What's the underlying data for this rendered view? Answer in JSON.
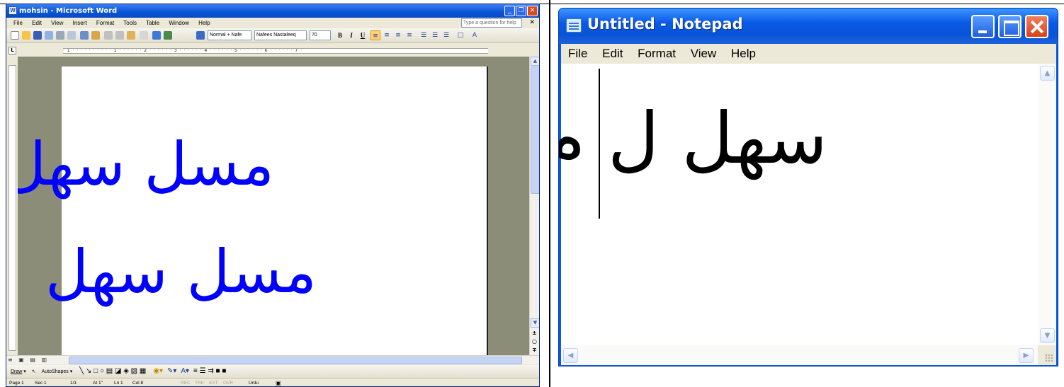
{
  "word": {
    "title": "mohsin - Microsoft Word",
    "caption_buttons": [
      "_",
      "❐",
      "✕"
    ],
    "menus": [
      "File",
      "Edit",
      "View",
      "Insert",
      "Format",
      "Tools",
      "Table",
      "Window",
      "Help"
    ],
    "help_box_placeholder": "Type a question for help",
    "help_close": "✕",
    "toolbar": {
      "style_value": "Normal + Nafe",
      "font_value": "Nafees Nastaleeq",
      "size_value": "70",
      "bold": "B",
      "italic": "I",
      "underline": "U"
    },
    "ruler_text": "· 1 · · · · · · · · · · 1 · · · · · · 2 · · · · · · 3 · · · · · · 4 · · · · · · 5 · · · · · · 6 · · · · · · 7 ·",
    "ruler_button": "L",
    "document_lines": [
      "مسل سهل",
      "مسل سهل"
    ],
    "draw_toolbar": {
      "draw": "Draw",
      "autoshapes": "AutoShapes"
    },
    "status": {
      "page": "Page 1",
      "sec": "Sec 1",
      "pages": "1/1",
      "at": "At 1\"",
      "ln": "Ln 1",
      "col": "Col 8",
      "rec": "REC",
      "trk": "TRK",
      "ext": "EXT",
      "ovr": "OVR",
      "language": "Urdu"
    },
    "colors": {
      "titlebar": "#0a57d8",
      "document_text": "#0000ff",
      "doc_background": "#8c8d78"
    }
  },
  "notepad": {
    "title": "Untitled - Notepad",
    "menus": [
      "File",
      "Edit",
      "Format",
      "View",
      "Help"
    ],
    "content": "سهل ل م ح",
    "scroll_up": "▲",
    "scroll_down": "▼",
    "scroll_left": "◀",
    "scroll_right": "▶",
    "colors": {
      "titlebar": "#0a5ae8",
      "close_button": "#d8421a"
    }
  }
}
